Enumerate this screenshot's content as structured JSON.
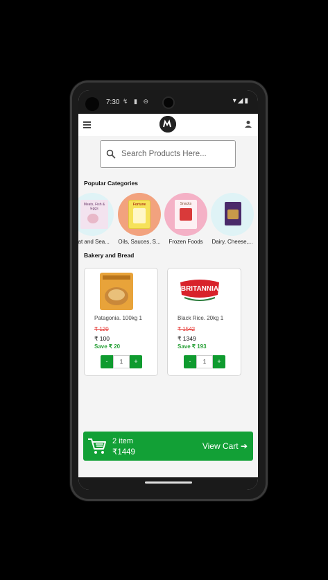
{
  "status": {
    "time": "7:30"
  },
  "search": {
    "placeholder": "Search Products Here..."
  },
  "sections": {
    "popular": "Popular Categories",
    "bakery": "Bakery and Bread"
  },
  "categories": [
    {
      "label": "eat and Sea...",
      "pack_text": "Meats, Fish & Eggs",
      "icon": "meat-icon"
    },
    {
      "label": "Oils, Sauces, S...",
      "pack_text": "Fortune",
      "icon": "oil-icon"
    },
    {
      "label": "Frozen Foods",
      "pack_text": "Snacks",
      "icon": "frozen-icon"
    },
    {
      "label": "Dairy, Cheese,...",
      "pack_text": "",
      "icon": "dairy-icon"
    }
  ],
  "products": [
    {
      "name": "Patagonia. 100kg 1",
      "mrp": "₹ 120",
      "price": "₹ 100",
      "save": "Save ₹ 20",
      "qty": "1",
      "brand": ""
    },
    {
      "name": "Black Rice. 20kg 1",
      "mrp": "₹ 1542",
      "price": "₹ 1349",
      "save": "Save ₹ 193",
      "qty": "1",
      "brand": "BRITANNIA"
    }
  ],
  "stepper": {
    "minus": "-",
    "plus": "+"
  },
  "cart": {
    "count": "2 item",
    "total": "₹1449",
    "action": "View Cart ➔"
  },
  "colors": {
    "accent": "#12a036",
    "mrp": "#e53935",
    "save": "#2aa139"
  }
}
